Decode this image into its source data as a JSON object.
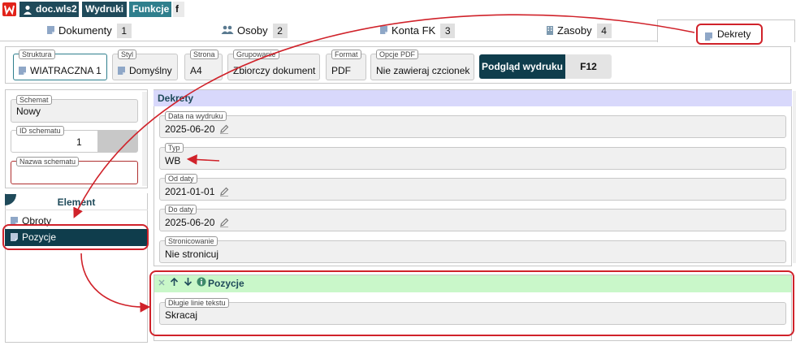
{
  "topbar": {
    "doc_label": "doc.wls2",
    "wydruki_label": "Wydruki",
    "funkcje_label": "Funkcje",
    "f_label": "f"
  },
  "tabs": [
    {
      "label": "Dokumenty",
      "num": "1",
      "icon": "document-icon"
    },
    {
      "label": "Osoby",
      "num": "2",
      "icon": "people-icon"
    },
    {
      "label": "Konta FK",
      "num": "3",
      "icon": "document-icon"
    },
    {
      "label": "Zasoby",
      "num": "4",
      "icon": "building-icon"
    }
  ],
  "active_tab": {
    "label": "Dekrety",
    "icon": "document-icon"
  },
  "toolbar": {
    "struktura": {
      "label": "Struktura",
      "value": "WIATRACZNA 1"
    },
    "styl": {
      "label": "Styl",
      "value": "Domyślny"
    },
    "strona": {
      "label": "Strona",
      "value": "A4"
    },
    "grupowanie": {
      "label": "Grupowanie",
      "value": "Zbiorczy dokument"
    },
    "format": {
      "label": "Format",
      "value": "PDF"
    },
    "opcje_pdf": {
      "label": "Opcje PDF",
      "value": "Nie zawieraj czcionek"
    },
    "preview_label": "Podgląd wydruku",
    "preview_key": "F12"
  },
  "left": {
    "schemat": {
      "label": "Schemat",
      "value": "Nowy"
    },
    "id_schematu": {
      "label": "ID schematu",
      "value": "1"
    },
    "nazwa_schematu": {
      "label": "Nazwa schematu",
      "value": ""
    },
    "element_header": "Element",
    "items": [
      {
        "label": "Obroty",
        "selected": false
      },
      {
        "label": "Pozycje",
        "selected": true
      }
    ]
  },
  "main": {
    "title": "Dekrety",
    "fields": [
      {
        "label": "Data na wydruku",
        "value": "2025-06-20",
        "editable": true
      },
      {
        "label": "Typ",
        "value": "WB",
        "editable": false
      },
      {
        "label": "Od daty",
        "value": "2021-01-01",
        "editable": true
      },
      {
        "label": "Do daty",
        "value": "2025-06-20",
        "editable": true
      },
      {
        "label": "Stronicowanie",
        "value": "Nie stronicuj",
        "editable": false
      }
    ]
  },
  "pozycje": {
    "title": "Pozycje",
    "field": {
      "label": "Długie linie tekstu",
      "value": "Skracaj"
    }
  },
  "colors": {
    "dark_teal": "#0f3d4c",
    "teal": "#2f7f8d",
    "header_lavender": "#d8d8fb",
    "header_green": "#c9f7c9",
    "annotation_red": "#d0222a"
  }
}
